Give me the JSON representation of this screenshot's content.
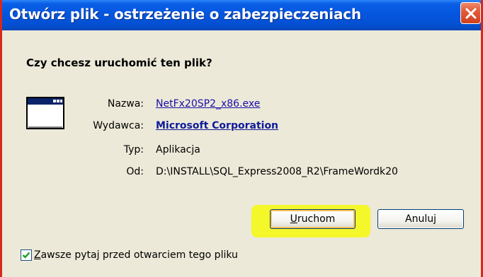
{
  "window": {
    "title": "Otwórz plik - ostrzeżenie o zabezpieczeniach",
    "close_icon": "close-icon"
  },
  "dialog": {
    "question": "Czy chcesz uruchomić ten plik?",
    "app_icon": "application-window-icon",
    "fields": {
      "name_label": "Nazwa:",
      "name_value": "NetFx20SP2_x86.exe",
      "publisher_label": "Wydawca:",
      "publisher_value": "Microsoft Corporation",
      "type_label": "Typ:",
      "type_value": "Aplikacja",
      "from_label": "Od:",
      "from_value": "D:\\INSTALL\\SQL_Express2008_R2\\FrameWordk20"
    },
    "buttons": {
      "run_mnemonic": "U",
      "run_rest": "ruchom",
      "cancel": "Anuluj"
    },
    "checkbox": {
      "checked": true,
      "label_mnemonic": "Z",
      "label_rest": "awsze pytaj przed otwarciem tego pliku"
    }
  },
  "colors": {
    "title_bar": "#0556de",
    "dialog_background": "#ece9d8",
    "highlight": "#f4f72a",
    "link": "#1a0fa8",
    "window_border": "#d42a1c"
  }
}
